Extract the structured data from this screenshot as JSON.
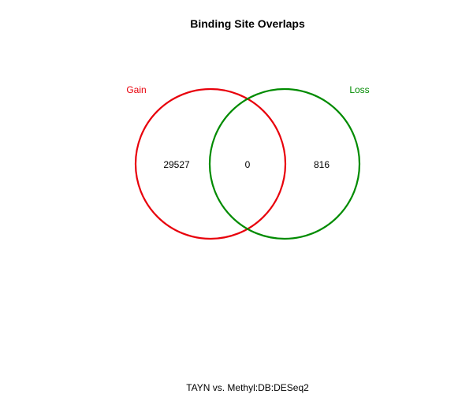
{
  "title": "Binding Site Overlaps",
  "footer": "TAYN vs. Methyl:DB:DESeq2",
  "sets": [
    {
      "name": "Gain",
      "color": "#e8000b"
    },
    {
      "name": "Loss",
      "color": "#008b00"
    }
  ],
  "counts": {
    "gain_only": "29527",
    "overlap": "0",
    "loss_only": "816"
  }
}
